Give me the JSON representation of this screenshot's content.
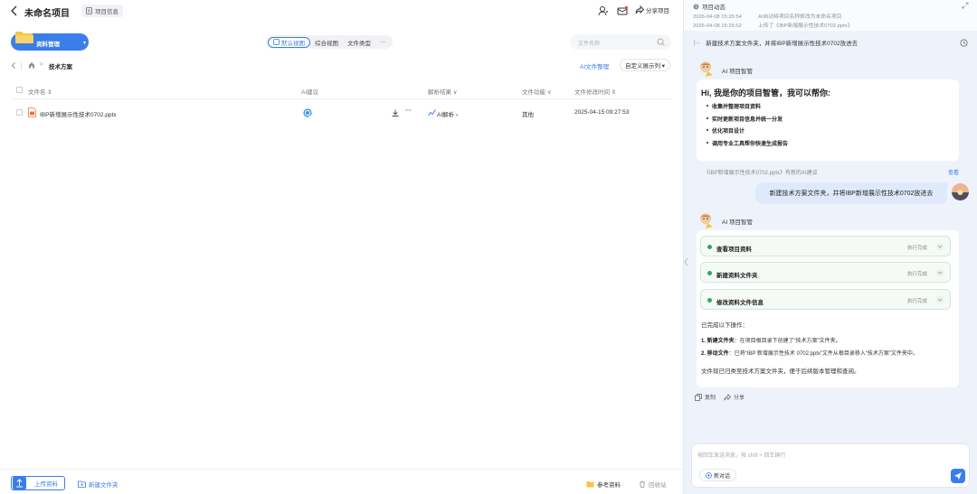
{
  "header": {
    "title": "未命名项目",
    "info_label": "项目信息",
    "share_label": "分享项目"
  },
  "toolbar": {
    "materials_label": "资料管理",
    "view_tabs": [
      "默认视图",
      "综合视图",
      "文件类型"
    ],
    "more_label": "···",
    "search_placeholder": "文件名称"
  },
  "breadcrumb": {
    "folder": "技术方案",
    "ai_organize": "AI文件整理",
    "custom_columns": "自定义展示列 ▾"
  },
  "table": {
    "columns": [
      "文件名 ⇕",
      "AI建议",
      "解析结果 ∨",
      "文件功能 ∨",
      "文件修改时间 ⇕"
    ],
    "rows": [
      {
        "name": "IBP新增展示性技术0702.pptx",
        "parse": "AI解析 ›",
        "function": "其他",
        "modified": "2025-04-15 09:27:53"
      }
    ]
  },
  "bottom": {
    "upload": "上传资料",
    "new_folder": "新建文件夹",
    "references": "参考资料",
    "trash": "回收站"
  },
  "feed": {
    "title": "项目动态",
    "items": [
      {
        "time": "2026-04-08 15:25:54",
        "text": "AI自动将项目名称修改为未命名项目"
      },
      {
        "time": "2026-04-08 15:25:52",
        "text": "上传了《IBP新增展示性技术0702.pptx》"
      }
    ]
  },
  "chat": {
    "header": "新建技术方案文件夹，并将IBP新增展示性技术0702放进去",
    "ai_name": "AI 项目智管",
    "greeting": "Hi, 我是你的项目智管，我可以帮你:",
    "capabilities": [
      "收集并整理项目资料",
      "实时更新项目信息并统一分发",
      "优化项目设计",
      "调用专业工具帮你快速生成报告"
    ],
    "suggestion": "《IBP新增展示性技术0702.pptx》有新的AI建议",
    "view_label": "查看",
    "user_message": "新建技术方案文件夹，并将IBP新增展示性技术0702放进去",
    "steps": [
      {
        "name": "查看项目资料",
        "status": "执行完成"
      },
      {
        "name": "新建资料文件夹",
        "status": "执行完成"
      },
      {
        "name": "修改资料文件信息",
        "status": "执行完成"
      }
    ],
    "done_title": "已完成以下操作：",
    "done_items": [
      {
        "label": "1. 新建文件夹",
        "text": "：在项目根目录下创建了“技术方案”文件夹。"
      },
      {
        "label": "2. 移动文件",
        "text": "：已将“IBP 新增展示性技术 0702.pptx”文件从根目录移入“技术方案”文件夹中。"
      }
    ],
    "summary": "文件现已归类至技术方案文件夹，便于后续版本管理和查阅。",
    "copy_label": "复制",
    "share_label": "分享",
    "input_placeholder": "按回车发送消息，按 shift + 回车换行",
    "new_chat_label": "新对话"
  },
  "colors": {
    "accent": "#3b7de9",
    "success": "#2eaa5a",
    "panel_bg": "#eef3fb"
  }
}
